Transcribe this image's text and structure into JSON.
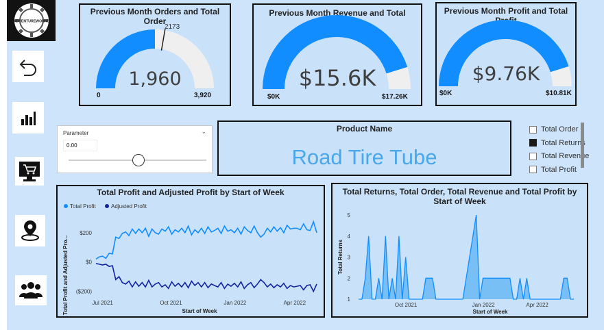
{
  "logo": {
    "text": "ADVENTUREWORKS"
  },
  "nav": [
    {
      "name": "back-icon"
    },
    {
      "name": "bar-chart-icon"
    },
    {
      "name": "shopping-cart-icon"
    },
    {
      "name": "map-pin-icon"
    },
    {
      "name": "users-icon"
    }
  ],
  "gauges": [
    {
      "title": "Previous Month Orders and Total Order",
      "value": "1,960",
      "min": "0",
      "max": "3,920",
      "target": "2173",
      "fill_fraction": 0.5,
      "target_fraction": 0.554
    },
    {
      "title": "Previous Month Revenue and Total Revenue",
      "value": "$15.6K",
      "min": "$0K",
      "max": "$17.26K",
      "fill_fraction": 0.904
    },
    {
      "title": "Previous Month Profit and Total Profit",
      "value": "$9.76K",
      "min": "$0K",
      "max": "$10.81K",
      "fill_fraction": 0.903
    }
  ],
  "parameter": {
    "label": "Parameter",
    "value": "0.00",
    "slider_fraction": 0.5
  },
  "product": {
    "label": "Product Name",
    "value": "Road Tire Tube"
  },
  "metric_selector": [
    {
      "label": "Total Order",
      "checked": false
    },
    {
      "label": "Total Returns",
      "checked": true
    },
    {
      "label": "Total Revenue",
      "checked": false
    },
    {
      "label": "Total Profit",
      "checked": false
    }
  ],
  "colors": {
    "accent": "#118dff",
    "dark_series": "#12239e",
    "gauge_track": "#efefef",
    "product_text": "#4aa8ea",
    "canvas": "#cde4fb"
  },
  "chart_data": [
    {
      "type": "line",
      "title": "Total Profit and Adjusted Profit by Start of Week",
      "xlabel": "Start of Week",
      "ylabel": "Total Profit and Adjusted Pro...",
      "x_ticks": [
        "Jul 2021",
        "Oct 2021",
        "Jan 2022",
        "Apr 2022"
      ],
      "y_ticks": [
        "$200",
        "$0",
        "($200)"
      ],
      "ylim": [
        -230,
        330
      ],
      "legend": "top-left",
      "series": [
        {
          "name": "Total Profit",
          "color": "#118dff",
          "values": [
            20,
            35,
            40,
            25,
            60,
            55,
            170,
            160,
            195,
            205,
            180,
            225,
            195,
            225,
            200,
            230,
            175,
            225,
            200,
            190,
            225,
            210,
            240,
            190,
            220,
            205,
            230,
            200,
            245,
            185,
            220,
            200,
            230,
            195,
            240,
            205,
            215,
            230,
            195,
            245,
            210,
            220,
            200,
            230,
            190,
            240,
            215,
            200,
            245,
            200,
            170,
            190,
            230,
            205,
            240,
            210,
            235,
            200,
            250,
            225,
            230,
            230,
            220,
            260,
            220,
            215,
            275,
            200
          ]
        },
        {
          "name": "Adjusted Profit",
          "color": "#12239e",
          "values": [
            -10,
            -15,
            -20,
            -15,
            -30,
            -25,
            -120,
            -100,
            -140,
            -150,
            -130,
            -170,
            -135,
            -165,
            -140,
            -170,
            -125,
            -170,
            -150,
            -140,
            -170,
            -155,
            -180,
            -135,
            -165,
            -145,
            -170,
            -140,
            -175,
            -130,
            -160,
            -140,
            -170,
            -140,
            -175,
            -150,
            -160,
            -170,
            -140,
            -180,
            -150,
            -165,
            -145,
            -170,
            -135,
            -180,
            -155,
            -140,
            -175,
            -150,
            -120,
            -140,
            -170,
            -150,
            -175,
            -155,
            -170,
            -145,
            -180,
            -160,
            -170,
            -165,
            -160,
            -190,
            -160,
            -155,
            -200,
            -150
          ]
        }
      ]
    },
    {
      "type": "area",
      "title": "Total Returns, Total Order, Total Revenue and Total Profit by Start of Week",
      "xlabel": "Start of Week",
      "ylabel": "Total Returns",
      "x_ticks": [
        "Oct 2021",
        "Jan 2022",
        "Apr 2022"
      ],
      "y_ticks": [
        5,
        4,
        3,
        2,
        1
      ],
      "ylim": [
        1,
        5
      ],
      "color": "#118dff",
      "values": [
        1,
        1,
        2,
        4,
        1,
        1,
        2,
        1,
        4,
        1,
        2,
        1,
        4,
        1,
        3,
        1,
        1,
        1,
        1,
        1,
        2,
        2,
        2,
        1,
        1,
        1,
        1,
        1,
        1,
        1,
        1,
        1,
        2,
        3,
        4,
        5,
        1,
        2,
        2,
        2,
        2,
        2,
        2,
        2,
        2,
        2,
        1,
        1,
        2,
        1,
        2,
        1,
        1,
        1,
        1,
        1,
        1,
        1,
        1,
        1,
        1,
        2,
        2,
        1,
        1
      ]
    }
  ]
}
